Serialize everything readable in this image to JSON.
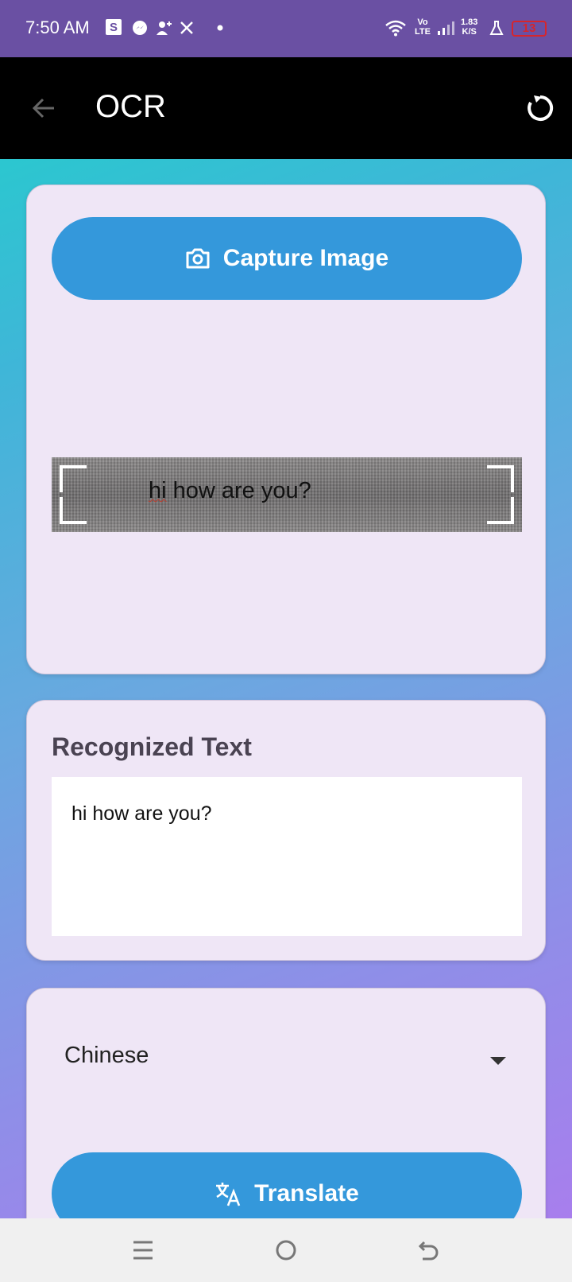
{
  "status_bar": {
    "time": "7:50 AM",
    "notif_s_label": "S",
    "net_top": "Vo",
    "net_bottom": "LTE",
    "speed_top": "1.83",
    "speed_bottom": "K/S",
    "battery": "13",
    "battery_color": "#d6252c"
  },
  "app_bar": {
    "title": "OCR",
    "back_icon": "arrow-left-icon",
    "refresh_icon": "refresh-icon"
  },
  "capture_card": {
    "button_label": "Capture Image",
    "button_icon": "camera-icon",
    "preview_text": "hi how are you?"
  },
  "recognized_card": {
    "title": "Recognized Text",
    "text": "hi how are you?"
  },
  "translate_card": {
    "language_selected": "Chinese",
    "button_label": "Translate",
    "button_icon": "translate-icon"
  },
  "colors": {
    "accent": "#3498db",
    "card_bg": "#efe6f6",
    "status_bar_bg": "#6a50a3",
    "app_bar_bg": "#000000"
  }
}
